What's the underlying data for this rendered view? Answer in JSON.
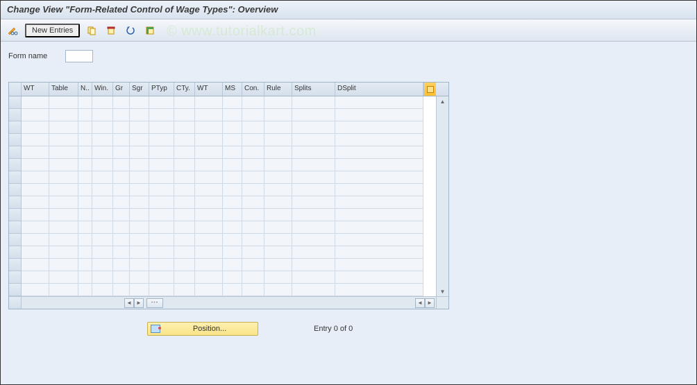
{
  "header": {
    "title": "Change View \"Form-Related Control of Wage Types\": Overview"
  },
  "watermark": "© www.tutorialkart.com",
  "toolbar": {
    "new_entries_label": "New Entries"
  },
  "form": {
    "name_label": "Form name",
    "name_value": ""
  },
  "grid": {
    "columns": [
      {
        "key": "sel",
        "label": "",
        "w": 18
      },
      {
        "key": "wt1",
        "label": "WT",
        "w": 40
      },
      {
        "key": "tbl",
        "label": "Table",
        "w": 42
      },
      {
        "key": "n",
        "label": "N..",
        "w": 20
      },
      {
        "key": "win",
        "label": "Win.",
        "w": 30
      },
      {
        "key": "gr",
        "label": "Gr",
        "w": 24
      },
      {
        "key": "sgr",
        "label": "Sgr",
        "w": 28
      },
      {
        "key": "ptyp",
        "label": "PTyp",
        "w": 36
      },
      {
        "key": "cty",
        "label": "CTy.",
        "w": 30
      },
      {
        "key": "wt2",
        "label": "WT",
        "w": 40
      },
      {
        "key": "ms",
        "label": "MS",
        "w": 28
      },
      {
        "key": "con",
        "label": "Con.",
        "w": 32
      },
      {
        "key": "rule",
        "label": "Rule",
        "w": 40
      },
      {
        "key": "splt",
        "label": "Splits",
        "w": 62
      },
      {
        "key": "dspl",
        "label": "DSplit",
        "w": 127
      }
    ],
    "row_count": 16
  },
  "footer": {
    "position_label": "Position...",
    "entry_text": "Entry 0 of 0"
  }
}
